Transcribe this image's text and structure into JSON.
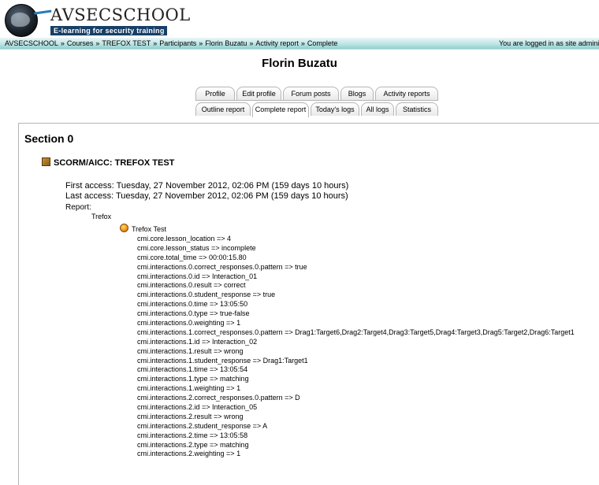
{
  "header": {
    "logo_name": "AVSECSCHOOL",
    "tagline": "E-learning for security training"
  },
  "navbar": {
    "breadcrumb": [
      "AVSECSCHOOL",
      "Courses",
      "TREFOX TEST",
      "Participants",
      "Florin Buzatu",
      "Activity report",
      "Complete"
    ],
    "separator": "»",
    "login_info": "You are logged in as site administrati"
  },
  "page_title": "Florin Buzatu",
  "tabs_row1": [
    "Profile",
    "Edit profile",
    "Forum posts",
    "Blogs",
    "Activity reports"
  ],
  "tabs_row2": [
    "Outline report",
    "Complete report",
    "Today's logs",
    "All logs",
    "Statistics"
  ],
  "active_tab": "Complete report",
  "section": {
    "title": "Section 0",
    "module_title": "SCORM/AICC: TREFOX TEST",
    "first_access": "First access: Tuesday, 27 November 2012, 02:06 PM (159 days 10 hours)",
    "last_access": "Last access: Tuesday, 27 November 2012, 02:06 PM (159 days 10 hours)",
    "report_label": "Report:",
    "sco_name": "Trefox",
    "test_name": "Trefox Test",
    "tracks": [
      "cmi.core.lesson_location => 4",
      "cmi.core.lesson_status => incomplete",
      "cmi.core.total_time => 00:00:15.80",
      "cmi.interactions.0.correct_responses.0.pattern => true",
      "cmi.interactions.0.id => Interaction_01",
      "cmi.interactions.0.result => correct",
      "cmi.interactions.0.student_response => true",
      "cmi.interactions.0.time => 13:05:50",
      "cmi.interactions.0.type => true-false",
      "cmi.interactions.0.weighting => 1",
      "cmi.interactions.1.correct_responses.0.pattern => Drag1:Target6,Drag2:Target4,Drag3:Target5,Drag4:Target3,Drag5:Target2,Drag6:Target1",
      "cmi.interactions.1.id => Interaction_02",
      "cmi.interactions.1.result => wrong",
      "cmi.interactions.1.student_response => Drag1:Target1",
      "cmi.interactions.1.time => 13:05:54",
      "cmi.interactions.1.type => matching",
      "cmi.interactions.1.weighting => 1",
      "cmi.interactions.2.correct_responses.0.pattern => D",
      "cmi.interactions.2.id => Interaction_05",
      "cmi.interactions.2.result => wrong",
      "cmi.interactions.2.student_response => A",
      "cmi.interactions.2.time => 13:05:58",
      "cmi.interactions.2.type => matching",
      "cmi.interactions.2.weighting => 1"
    ]
  }
}
